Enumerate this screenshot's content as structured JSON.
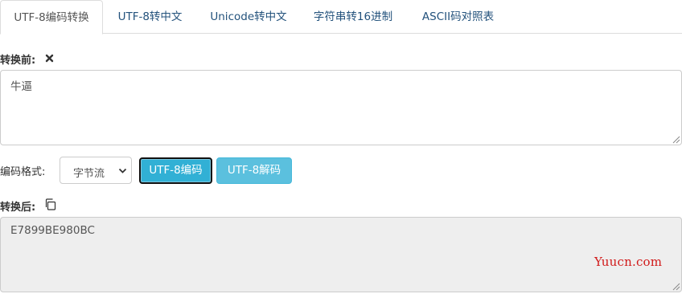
{
  "tabs": [
    {
      "label": "UTF-8编码转换",
      "active": true
    },
    {
      "label": "UTF-8转中文",
      "active": false
    },
    {
      "label": "Unicode转中文",
      "active": false
    },
    {
      "label": "字符串转16进制",
      "active": false
    },
    {
      "label": "ASCII码对照表",
      "active": false
    }
  ],
  "before": {
    "label": "转换前:",
    "value": "牛逼",
    "clear_icon": "close-icon"
  },
  "format": {
    "label": "编码格式:",
    "selected": "字节流"
  },
  "buttons": {
    "encode": "UTF-8编码",
    "decode": "UTF-8解码"
  },
  "after": {
    "label": "转换后:",
    "value": "E7899BE980BC",
    "copy_icon": "copy-icon"
  },
  "watermark": "Yuucn.com",
  "colors": {
    "tab_link": "#23527c",
    "btn_encode": "#31b0d5",
    "btn_decode": "#5bc0de",
    "readonly_bg": "#eeeeee",
    "watermark": "#d11a1a"
  }
}
